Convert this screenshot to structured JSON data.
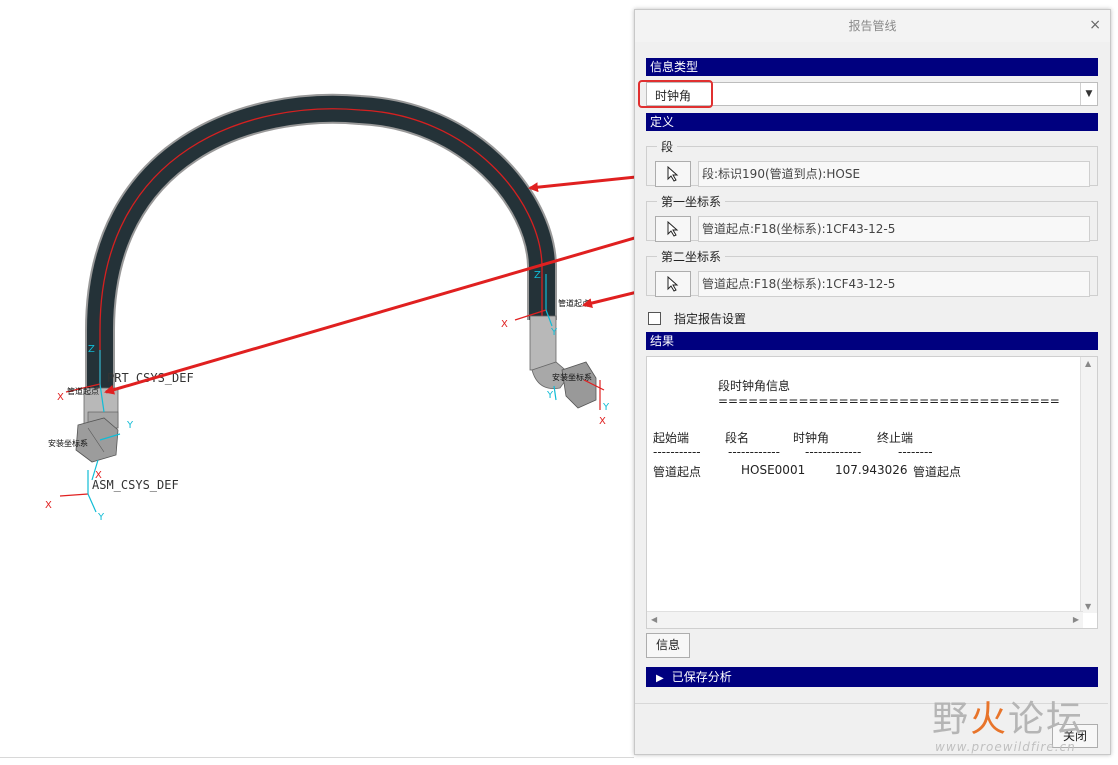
{
  "dialog": {
    "title": "报告管线",
    "close_icon": "×",
    "info_type": {
      "header": "信息类型",
      "selected": "时钟角"
    },
    "definition": {
      "header": "定义",
      "segment": {
        "legend": "段",
        "value": "段:标识190(管道到点):HOSE"
      },
      "first_csys": {
        "legend": "第一坐标系",
        "value": "管道起点:F18(坐标系):1CF43-12-5"
      },
      "second_csys": {
        "legend": "第二坐标系",
        "value": "管道起点:F18(坐标系):1CF43-12-5"
      }
    },
    "specify_report_settings": "指定报告设置",
    "results": {
      "header": "结果",
      "report_title": "段时钟角信息",
      "separator": "==================================",
      "columns": [
        "起始端",
        "段名",
        "时钟角",
        "终止端"
      ],
      "dashes": [
        "-----------",
        "------------",
        "-------------",
        "--------"
      ],
      "row": [
        "管道起点",
        "HOSE0001",
        "107.943026",
        "管道起点"
      ]
    },
    "info_button": "信息",
    "saved_analysis": "已保存分析",
    "close_button": "关闭"
  },
  "viewport": {
    "labels": {
      "prt_csys": "PRT_CSYS_DEF",
      "asm_csys": "ASM_CSYS_DEF",
      "pipe_start_left": "管道起点",
      "install_csys_left": "安装坐标系",
      "pipe_start_right": "管道起点",
      "install_csys_right": "安装坐标系"
    },
    "axes": {
      "x": "X",
      "y": "Y",
      "z": "Z"
    }
  },
  "watermark": {
    "text_gray": "野",
    "text_red": "火",
    "text_gray2": "论坛",
    "url": "www.proewildfire.cn"
  },
  "colors": {
    "title_bar": "#00007f",
    "annotation": "#e02020",
    "pipe": "#253238"
  }
}
